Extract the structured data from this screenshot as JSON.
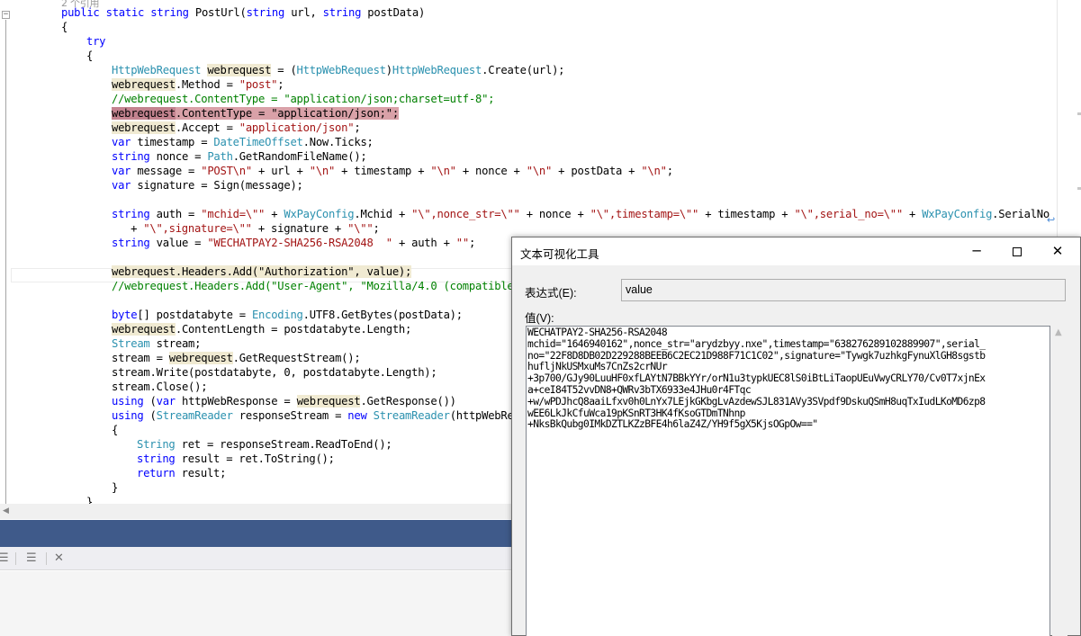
{
  "editor": {
    "collapse_glyph": "−",
    "codelens": "2 个引用",
    "wrap_glyph": "↩",
    "lines": [
      [
        [
          "kw",
          "public "
        ],
        [
          "kw",
          "static "
        ],
        [
          "kw",
          "string "
        ],
        [
          "",
          "PostUrl("
        ],
        [
          "kw",
          "string "
        ],
        [
          "",
          "url, "
        ],
        [
          "kw",
          "string "
        ],
        [
          "",
          "postData)"
        ]
      ],
      [
        [
          "",
          "{"
        ]
      ],
      [
        [
          "kw",
          "try"
        ]
      ],
      [
        [
          "",
          "{"
        ]
      ],
      [
        [
          "ty",
          "HttpWebRequest "
        ],
        [
          "hl",
          "webrequest"
        ],
        [
          "",
          " = ("
        ],
        [
          "ty",
          "HttpWebRequest"
        ],
        [
          "",
          ")"
        ],
        [
          "ty",
          "HttpWebRequest"
        ],
        [
          "",
          ".Create(url);"
        ]
      ],
      [
        [
          "hl",
          "webrequest"
        ],
        [
          "",
          ".Method = "
        ],
        [
          "st",
          "\"post\""
        ],
        [
          "",
          ";"
        ]
      ],
      [
        [
          "cm",
          "//webrequest.ContentType = \"application/json;charset=utf-8\";"
        ]
      ],
      [
        [
          "bp-hl",
          "webrequest"
        ],
        [
          "bp",
          ".ContentType = "
        ],
        [
          "bp",
          "\"application/json;\";"
        ]
      ],
      [
        [
          "hl",
          "webrequest"
        ],
        [
          "",
          ".Accept = "
        ],
        [
          "st",
          "\"application/json\""
        ],
        [
          "",
          ";"
        ]
      ],
      [
        [
          "kw",
          "var "
        ],
        [
          "",
          "timestamp = "
        ],
        [
          "ty",
          "DateTimeOffset"
        ],
        [
          "",
          ".Now.Ticks;"
        ]
      ],
      [
        [
          "kw",
          "string "
        ],
        [
          "",
          "nonce = "
        ],
        [
          "ty",
          "Path"
        ],
        [
          "",
          ".GetRandomFileName();"
        ]
      ],
      [
        [
          "kw",
          "var "
        ],
        [
          "",
          "message = "
        ],
        [
          "st",
          "\"POST\\n\""
        ],
        [
          "",
          " + url + "
        ],
        [
          "st",
          "\"\\n\""
        ],
        [
          "",
          " + timestamp + "
        ],
        [
          "st",
          "\"\\n\""
        ],
        [
          "",
          " + nonce + "
        ],
        [
          "st",
          "\"\\n\""
        ],
        [
          "",
          " + postData + "
        ],
        [
          "st",
          "\"\\n\""
        ],
        [
          "",
          ";"
        ]
      ],
      [
        [
          "kw",
          "var "
        ],
        [
          "",
          "signature = Sign(message);"
        ]
      ],
      [],
      [
        [
          "kw",
          "string "
        ],
        [
          "",
          "auth = "
        ],
        [
          "st",
          "\"mchid=\\\"\""
        ],
        [
          "",
          " + "
        ],
        [
          "ty",
          "WxPayConfig"
        ],
        [
          "",
          ".Mchid + "
        ],
        [
          "st",
          "\"\\\",nonce_str=\\\"\""
        ],
        [
          "",
          " + nonce + "
        ],
        [
          "st",
          "\"\\\",timestamp=\\\"\""
        ],
        [
          "",
          " + timestamp + "
        ],
        [
          "st",
          "\"\\\",serial_no=\\\"\""
        ],
        [
          "",
          " + "
        ],
        [
          "ty",
          "WxPayConfig"
        ],
        [
          "",
          ".SerialNo"
        ]
      ],
      [
        [
          "",
          " + "
        ],
        [
          "st",
          "\"\\\",signature=\\\"\""
        ],
        [
          "",
          " + signature + "
        ],
        [
          "st",
          "\"\\\"\""
        ],
        [
          "",
          ";"
        ]
      ],
      [
        [
          "kw",
          "string "
        ],
        [
          "",
          "value = "
        ],
        [
          "st",
          "\"WECHATPAY2-SHA256-RSA2048  \""
        ],
        [
          "",
          " + auth + "
        ],
        [
          "st",
          "\"\""
        ],
        [
          "",
          ";"
        ]
      ],
      [],
      [
        [
          "hl",
          "webrequest.Headers.Add(\"Authorization\", value);"
        ]
      ],
      [
        [
          "cm",
          "//webrequest.Headers.Add(\"User-Agent\", \"Mozilla/4.0 (compatible"
        ]
      ],
      [],
      [
        [
          "kw",
          "byte"
        ],
        [
          "",
          "[] postdatabyte = "
        ],
        [
          "ty",
          "Encoding"
        ],
        [
          "",
          ".UTF8.GetBytes(postData);"
        ]
      ],
      [
        [
          "hl",
          "webrequest"
        ],
        [
          "",
          ".ContentLength = postdatabyte.Length;"
        ]
      ],
      [
        [
          "ty",
          "Stream "
        ],
        [
          "",
          "stream;"
        ]
      ],
      [
        [
          "",
          "stream = "
        ],
        [
          "hl",
          "webrequest"
        ],
        [
          "",
          ".GetRequestStream();"
        ]
      ],
      [
        [
          "",
          "stream.Write(postdatabyte, 0, postdatabyte.Length);"
        ]
      ],
      [
        [
          "",
          "stream.Close();"
        ]
      ],
      [
        [
          "kw",
          "using "
        ],
        [
          "",
          "("
        ],
        [
          "kw",
          "var "
        ],
        [
          "",
          "httpWebResponse = "
        ],
        [
          "hl",
          "webrequest"
        ],
        [
          "",
          ".GetResponse())"
        ]
      ],
      [
        [
          "kw",
          "using "
        ],
        [
          "",
          "("
        ],
        [
          "ty",
          "StreamReader "
        ],
        [
          "",
          "responseStream = "
        ],
        [
          "kw",
          "new "
        ],
        [
          "ty",
          "StreamReader"
        ],
        [
          "",
          "(httpWebRes"
        ]
      ],
      [
        [
          "",
          "{"
        ]
      ],
      [
        [
          "ty",
          "String "
        ],
        [
          "",
          "ret = responseStream.ReadToEnd();"
        ]
      ],
      [
        [
          "kw",
          "string "
        ],
        [
          "",
          "result = ret.ToString();"
        ]
      ],
      [
        [
          "kw",
          "return "
        ],
        [
          "",
          "result;"
        ]
      ],
      [
        [
          "",
          "}"
        ]
      ],
      [
        [
          "",
          "}"
        ]
      ]
    ]
  },
  "panel": {
    "toolbar_icons": [
      "align-left-icon",
      "align-center-icon",
      "clear-icon"
    ],
    "toolbar_glyphs": [
      "☰",
      "☰",
      "✕"
    ]
  },
  "dialog": {
    "title": "文本可视化工具",
    "minimize_glyph": "─",
    "close_glyph": "✕",
    "expression_label": "表达式(E):",
    "expression_value": "value",
    "value_label": "值(V):",
    "value_text": "WECHATPAY2-SHA256-RSA2048\nmchid=\"1646940162\",nonce_str=\"arydzbyy.nxe\",timestamp=\"638276289102889907\",serial_\nno=\"22F8D8DB02D229288BEEB6C2EC21D988F71C1C02\",signature=\"Tywgk7uzhkgFynuXlGH8sgstb\nhufljNkUSMxuMs7CnZs2crNUr\n+3p700/GJy90LuuHF0xfLAYtN7BBkYYr/orN1u3typkUEC8lS0iBtLiTaopUEuVwyCRLY70/Cv0T7xjnEx\na+ceI84T52vvDN8+QWRv3bTX6933e4JHu0r4FTqc\n+w/wPDJhcQ8aaiLfxv0h0LnYx7LEjkGKbgLvAzdewSJL831AVy3SVpdf9DskuQSmH8uqTxIudLKoMD6zp8\nwEE6LkJkCfuWca19pKSnRT3HK4fKsoGTDmTNhnp\n+NksBkQubg0IMkDZTLKZzBFE4h6laZ4Z/YH9f5gX5KjsOGpOw==\"",
    "scroll_up_glyph": "▲"
  }
}
